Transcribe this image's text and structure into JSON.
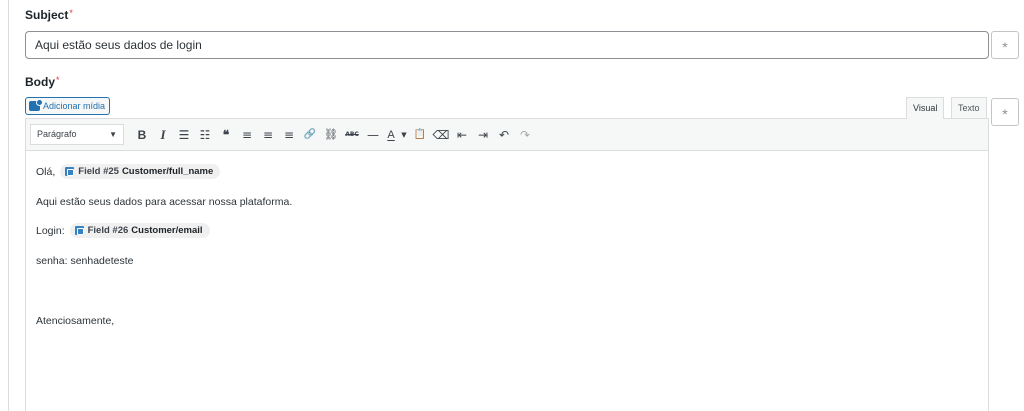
{
  "subject": {
    "label": "Subject",
    "required_mark": "*",
    "value": "Aqui estão seus dados de login",
    "side_button": "*"
  },
  "body": {
    "label": "Body",
    "required_mark": "*",
    "media_button": "Adicionar mídia",
    "tabs": {
      "visual": "Visual",
      "text": "Texto"
    },
    "side_button": "*",
    "toolbar": {
      "format_value": "Parágrafo",
      "format_caret": "▼",
      "bold": "B",
      "italic": "I",
      "bullet_list": "☰",
      "numbered_list": "☷",
      "blockquote": "❝",
      "align_left": "≡",
      "align_center": "≡",
      "align_right": "≡",
      "link": "🔗",
      "unlink": "⛓",
      "strikethrough": "ABC",
      "hr": "—",
      "text_color": "A",
      "text_color_caret": "▼",
      "paste_text": "📋",
      "clear_format": "⌫",
      "outdent": "⇤",
      "indent": "⇥",
      "undo": "↶",
      "redo": "↷"
    },
    "content": {
      "greeting": "Olá,",
      "field1": {
        "prefix": "Field #25",
        "name": "Customer/full_name"
      },
      "line2": "Aqui estão seus dados para acessar nossa plataforma.",
      "login_label": "Login:",
      "field2": {
        "prefix": "Field #26",
        "name": "Customer/email"
      },
      "password_line": "senha: senhadeteste",
      "closing": "Atenciosamente,"
    }
  }
}
